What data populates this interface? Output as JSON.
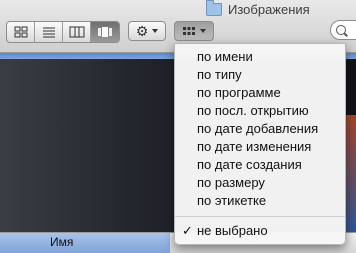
{
  "window": {
    "title": "Изображения"
  },
  "toolbar": {
    "view_buttons": [
      {
        "name": "icon-view",
        "active": false
      },
      {
        "name": "list-view",
        "active": false
      },
      {
        "name": "column-view",
        "active": false
      },
      {
        "name": "coverflow-view",
        "active": true
      }
    ],
    "action_icon": "gear-icon",
    "arrange_icon": "grid-icon"
  },
  "sort_menu": {
    "items": [
      "по имени",
      "по типу",
      "по программе",
      "по посл. открытию",
      "по дате добавления",
      "по дате изменения",
      "по дате создания",
      "по размеру",
      "по этикетке"
    ],
    "selected": {
      "check": "✓",
      "label": "не выбрано"
    }
  },
  "column_header": {
    "name_label": "Имя"
  },
  "colors": {
    "selected_header": "#7ea2d8",
    "content_bg": "#1c1d23",
    "menu_bg": "#f6f6f6"
  }
}
